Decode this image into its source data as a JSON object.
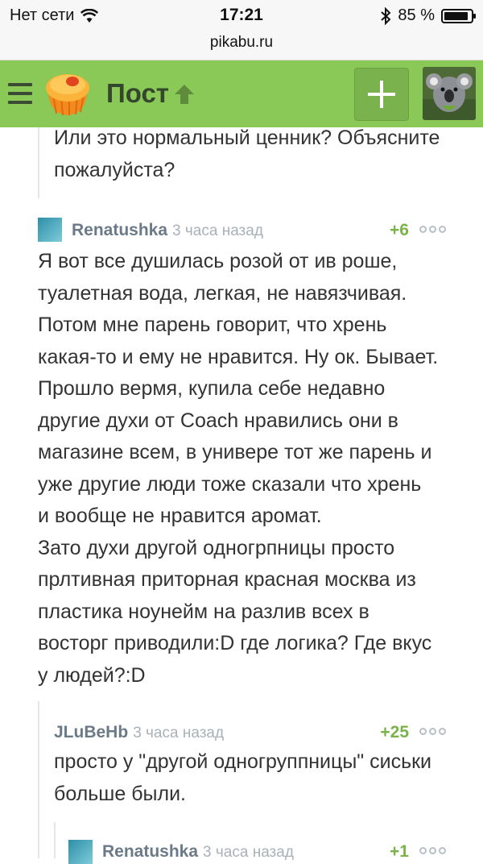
{
  "status_bar": {
    "carrier": "Нет сети",
    "time": "17:21",
    "battery": "85 %",
    "battery_level": 0.85
  },
  "url": "pikabu.ru",
  "header": {
    "title": "Пост",
    "add_icon": "plus-icon",
    "menu_icon": "hamburger-menu-icon"
  },
  "comments": [
    {
      "text": "Или это нормальный ценник? Объясните\nпожалуйста?"
    },
    {
      "user": "Renatushka",
      "time": "3 часа назад",
      "rating": "+6",
      "text": "Я вот все душилась розой от ив роше,\nтуалетная вода, легкая, не навязчивая.\nПотом мне парень говорит, что хрень\nкакая-то и ему не нравится. Ну ок. Бывает.\nПрошло вермя, купила себе недавно\nдругие духи от Coach нравились они в\nмагазине всем, в универе тот же парень и\nуже другие люди тоже сказали что хрень\nи вообще не нравится аромат.\nЗато духи другой одногрпницы просто\nпрлтивная приторная красная москва из\nпластика ноунейм на разлив всех в\nвосторг приводили:D где логика? Где вкус\nу людей?:D"
    },
    {
      "user": "JLuBeHb",
      "time": "3 часа назад",
      "rating": "+25",
      "text": "просто у \"другой одногруппницы\" сиськи\nбольше были."
    },
    {
      "user": "Renatushka",
      "time": "3 часа назад",
      "rating": "+1"
    }
  ],
  "colors": {
    "header_bg": "#8ac858",
    "rating_green": "#79b34a",
    "username": "#6b7a88"
  }
}
